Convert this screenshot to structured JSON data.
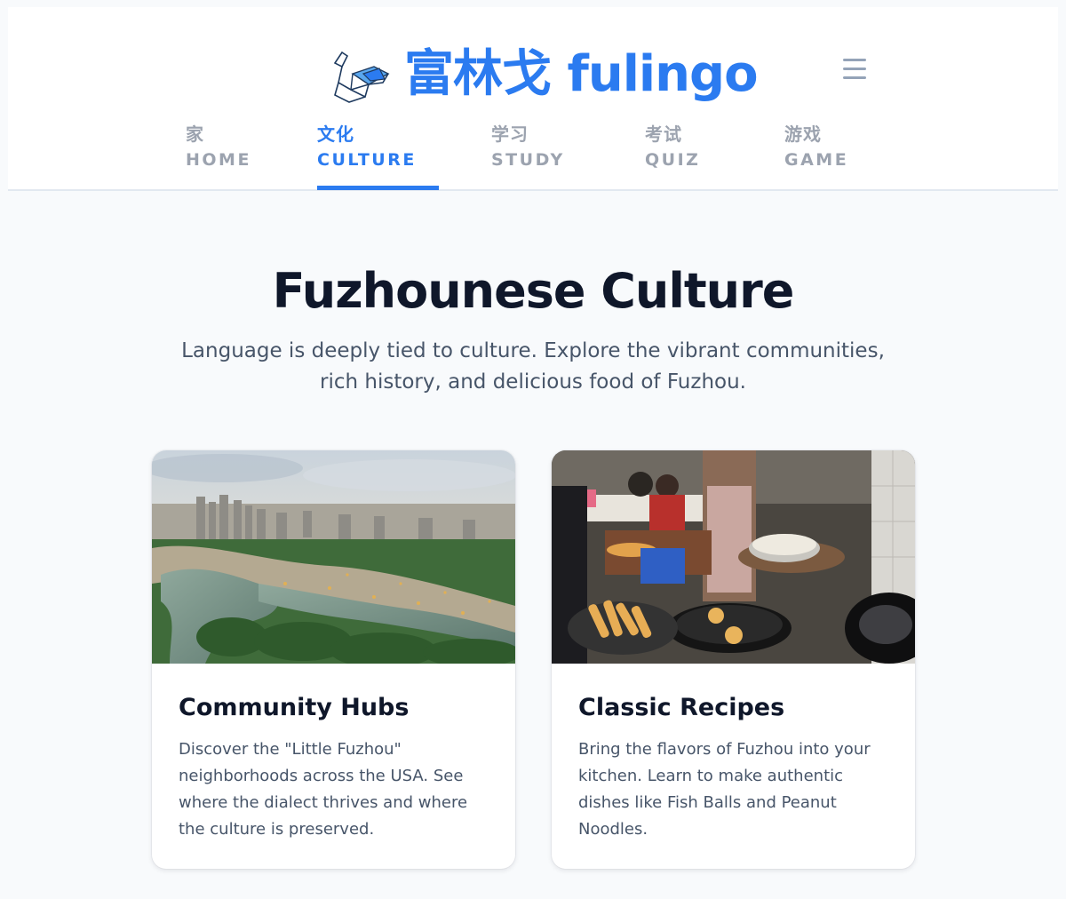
{
  "header": {
    "brand_text": "富林戈 fulingo",
    "logo_icon": "origami-swan-icon",
    "menu_icon": "hamburger-menu-icon",
    "accent_color": "#2b7bf0"
  },
  "nav": {
    "items": [
      {
        "zh": "家",
        "en": "HOME"
      },
      {
        "zh": "文化",
        "en": "CULTURE"
      },
      {
        "zh": "学习",
        "en": "STUDY"
      },
      {
        "zh": "考试",
        "en": "QUIZ"
      },
      {
        "zh": "游戏",
        "en": "GAME"
      }
    ],
    "active": "CULTURE"
  },
  "main": {
    "title": "Fuzhounese Culture",
    "subtitle": "Language is deeply tied to culture. Explore the vibrant communities, rich history, and delicious food of Fuzhou."
  },
  "cards": [
    {
      "title": "Community Hubs",
      "text": "Discover the \"Little Fuzhou\" neighborhoods across the USA. See where the dialect thrives and where the culture is preserved."
    },
    {
      "title": "Classic Recipes",
      "text": "Bring the flavors of Fuzhou into your kitchen. Learn to make authentic dishes like Fish Balls and Peanut Noodles."
    }
  ]
}
